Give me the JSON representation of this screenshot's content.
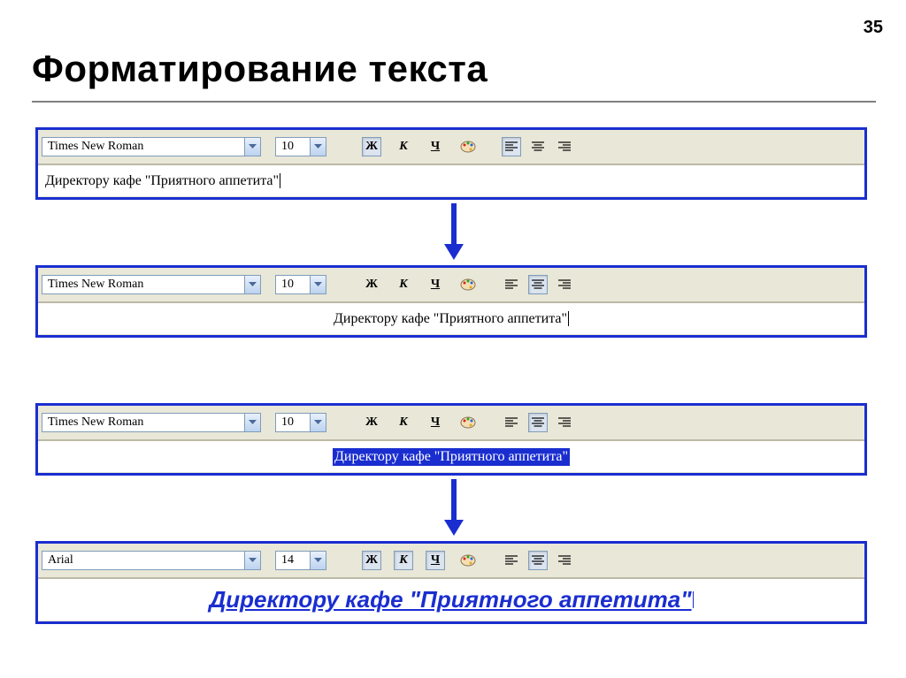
{
  "page_number": "35",
  "title": "Форматирование текста",
  "labels": {
    "bold": "Ж",
    "italic": "К",
    "underline": "Ч"
  },
  "panels": [
    {
      "font": "Times New Roman",
      "size": "10",
      "bold_pressed": true,
      "italic_pressed": false,
      "underline_pressed": false,
      "align": "left",
      "text": "Директору кафе \"Приятного аппетита\"",
      "text_align": "left",
      "text_style": "normal",
      "cursor": true
    },
    {
      "font": "Times New Roman",
      "size": "10",
      "bold_pressed": false,
      "italic_pressed": false,
      "underline_pressed": false,
      "align": "center",
      "text": "Директору кафе \"Приятного аппетита\"",
      "text_align": "center",
      "text_style": "normal",
      "cursor": true
    },
    {
      "font": "Times New Roman",
      "size": "10",
      "bold_pressed": false,
      "italic_pressed": false,
      "underline_pressed": false,
      "align": "center",
      "text": "Директору кафе \"Приятного аппетита\"",
      "text_align": "center",
      "text_style": "selected",
      "cursor": false
    },
    {
      "font": "Arial",
      "size": "14",
      "bold_pressed": true,
      "italic_pressed": true,
      "underline_pressed": true,
      "align": "center",
      "text": "Директору кафе \"Приятного аппетита\"",
      "text_align": "center",
      "text_style": "big",
      "cursor": true
    }
  ]
}
